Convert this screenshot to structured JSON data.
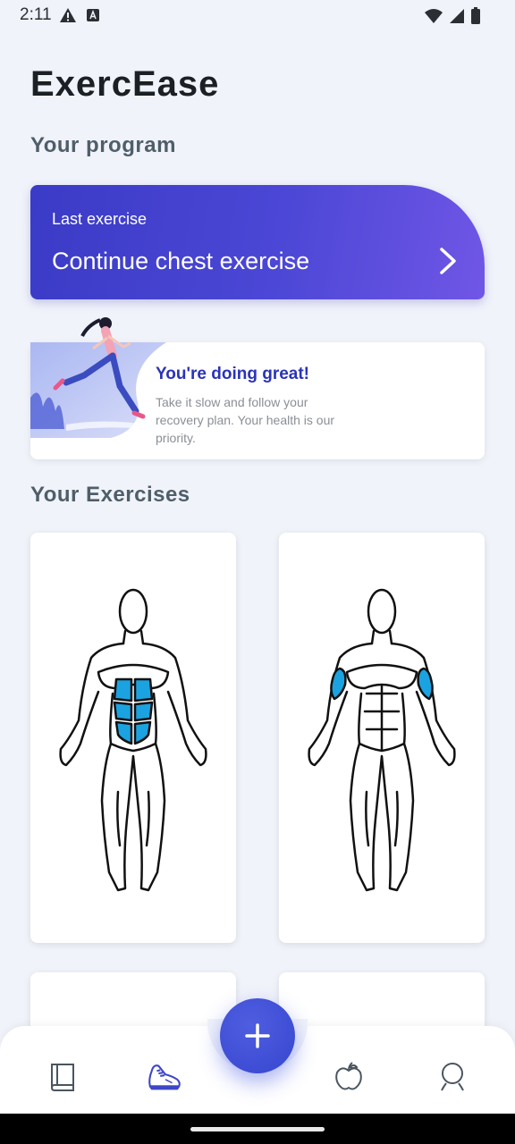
{
  "status_bar": {
    "time": "2:11"
  },
  "app": {
    "title": "ExercEase"
  },
  "program": {
    "section_title": "Your program",
    "card_subtitle": "Last exercise",
    "card_title": "Continue chest exercise"
  },
  "motivation": {
    "title": "You're doing great!",
    "body": "Take it slow and follow your recovery plan. Your health is our priority."
  },
  "exercises": {
    "section_title": "Your Exercises",
    "cards": [
      {
        "highlight": "abs"
      },
      {
        "highlight": "biceps"
      },
      {
        "highlight": ""
      },
      {
        "highlight": ""
      }
    ]
  },
  "nav": {
    "items": [
      {
        "icon": "book-icon",
        "active": false
      },
      {
        "icon": "shoe-icon",
        "active": true
      },
      {
        "icon": "apple-icon",
        "active": false
      },
      {
        "icon": "profile-icon",
        "active": false
      }
    ],
    "fab_icon": "plus-icon"
  },
  "colors": {
    "primary": "#3d3fcf",
    "accent_gradient_end": "#7056e6",
    "highlight_muscle": "#1aa3e0",
    "background": "#f1f3fa",
    "title_blue": "#2a33b8"
  }
}
